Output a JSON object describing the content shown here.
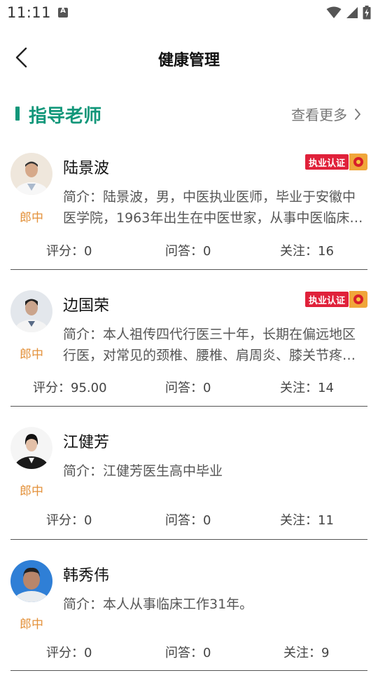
{
  "status_bar": {
    "time": "11:11",
    "notification_letter": "A",
    "icons": [
      "wifi-icon",
      "cellular-signal-icon",
      "battery-charging-icon"
    ]
  },
  "nav": {
    "back_icon": "chevron-left-icon",
    "title": "健康管理"
  },
  "section": {
    "title": "指导老师",
    "more_label": "查看更多",
    "more_icon": "chevron-right-icon",
    "accent_color": "#12977a"
  },
  "teachers": [
    {
      "name": "陆景波",
      "title": "郎中",
      "certified": true,
      "cert_label": "执业认证",
      "intro": "简介：陆景波，男，中医执业医师，毕业于安徽中医学院，1963年出生在中医世家，从事中医临床工作多年",
      "score_label": "评分：",
      "score": "0",
      "qa_label": "问答：",
      "qa": "0",
      "follow_label": "关注：",
      "follow": "16"
    },
    {
      "name": "边国荣",
      "title": "郎中",
      "certified": true,
      "cert_label": "执业认证",
      "intro": "简介：本人祖传四代行医三十年，长期在偏远地区行医，对常见的颈椎、腰椎、肩周炎、膝关节疼痛有丰富经验",
      "score_label": "评分：",
      "score": "95.00",
      "qa_label": "问答：",
      "qa": "0",
      "follow_label": "关注：",
      "follow": "14"
    },
    {
      "name": "江健芳",
      "title": "郎中",
      "certified": false,
      "cert_label": "",
      "intro": "简介：江健芳医生高中毕业",
      "score_label": "评分：",
      "score": "0",
      "qa_label": "问答：",
      "qa": "0",
      "follow_label": "关注：",
      "follow": "11"
    },
    {
      "name": "韩秀伟",
      "title": "郎中",
      "certified": false,
      "cert_label": "",
      "intro": "简介：本人从事临床工作31年。",
      "score_label": "评分：",
      "score": "0",
      "qa_label": "问答：",
      "qa": "0",
      "follow_label": "关注：",
      "follow": "9"
    }
  ]
}
